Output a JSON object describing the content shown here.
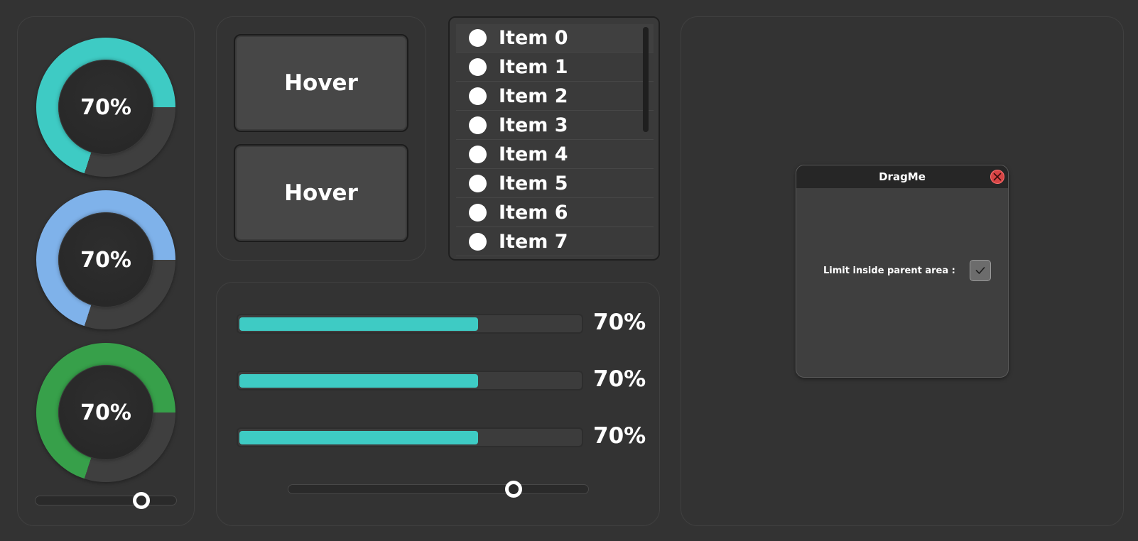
{
  "colors": {
    "background": "#333333",
    "teal": "#3ecbc4",
    "blue": "#7fb2ea",
    "green": "#37a04a",
    "gauge_track": "#3f3f3f",
    "close_red": "#d74545"
  },
  "gauges": [
    {
      "value_label": "70%",
      "percent": 70,
      "color": "#3ecbc4"
    },
    {
      "value_label": "70%",
      "percent": 70,
      "color": "#7fb2ea"
    },
    {
      "value_label": "70%",
      "percent": 70,
      "color": "#37a04a"
    }
  ],
  "gauge_slider": {
    "value": 0.75
  },
  "buttons": [
    {
      "label": "Hover"
    },
    {
      "label": "Hover"
    }
  ],
  "list": {
    "items": [
      "Item 0",
      "Item 1",
      "Item 2",
      "Item 3",
      "Item 4",
      "Item 5",
      "Item 6",
      "Item 7"
    ]
  },
  "progress": [
    {
      "label": "70%",
      "percent": 70
    },
    {
      "label": "70%",
      "percent": 70
    },
    {
      "label": "70%",
      "percent": 70
    }
  ],
  "progress_slider": {
    "value": 0.75
  },
  "dragme": {
    "title": "DragMe",
    "close_icon": "close-x-icon",
    "checkbox_label": "Limit inside parent area :",
    "checked": true,
    "check_icon": "checkmark-icon"
  }
}
